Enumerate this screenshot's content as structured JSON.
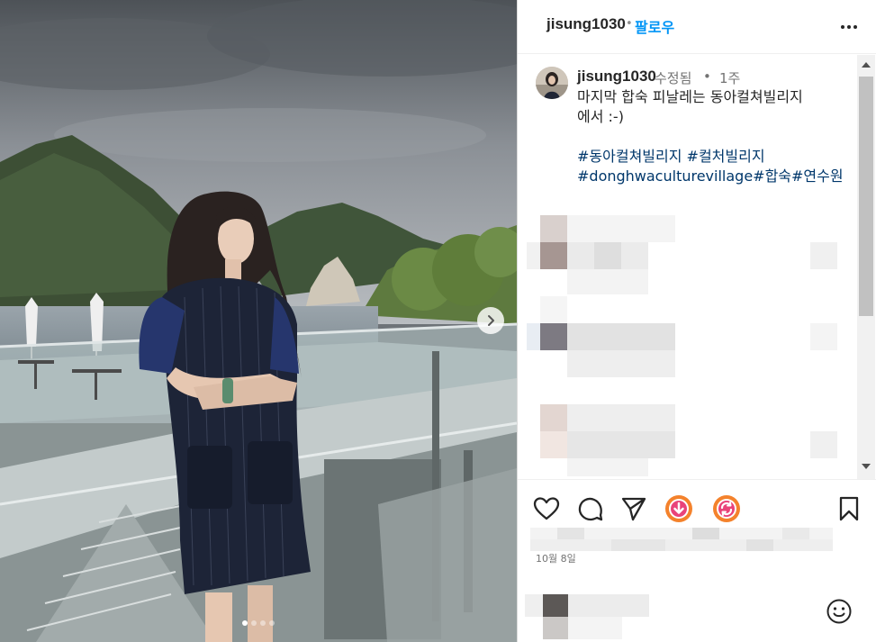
{
  "post": {
    "photo_alt": "",
    "carousel": {
      "total": 4,
      "current": 1
    }
  },
  "header": {
    "username": "jisung1030",
    "separator": "•",
    "follow_label": "팔로우"
  },
  "caption": {
    "username": "jisung1030",
    "edited": "수정됨",
    "separator": "•",
    "time_ago": "1주",
    "text": "마지막 합숙 피날레는 동아컬쳐빌리지\n에서 :-)",
    "hashtags": [
      "#동아컬쳐빌리지",
      "#컬처빌리지",
      "#donghwaculturevillage",
      "#합숙",
      "#연수원"
    ]
  },
  "footer": {
    "date": "10월 8일"
  },
  "icons": {
    "more": "more-horizontal-icon",
    "next": "chevron-right-icon",
    "like": "heart-icon",
    "comment": "comment-icon",
    "share": "send-icon",
    "download": "download-extension-icon",
    "sync": "sync-extension-icon",
    "save": "bookmark-icon",
    "emoji": "smiley-icon"
  },
  "colors": {
    "link": "#0095f6",
    "hashtag": "#00376b",
    "muted": "#737373",
    "extension_orange": "#f4822c",
    "extension_pink": "#e9437a"
  }
}
